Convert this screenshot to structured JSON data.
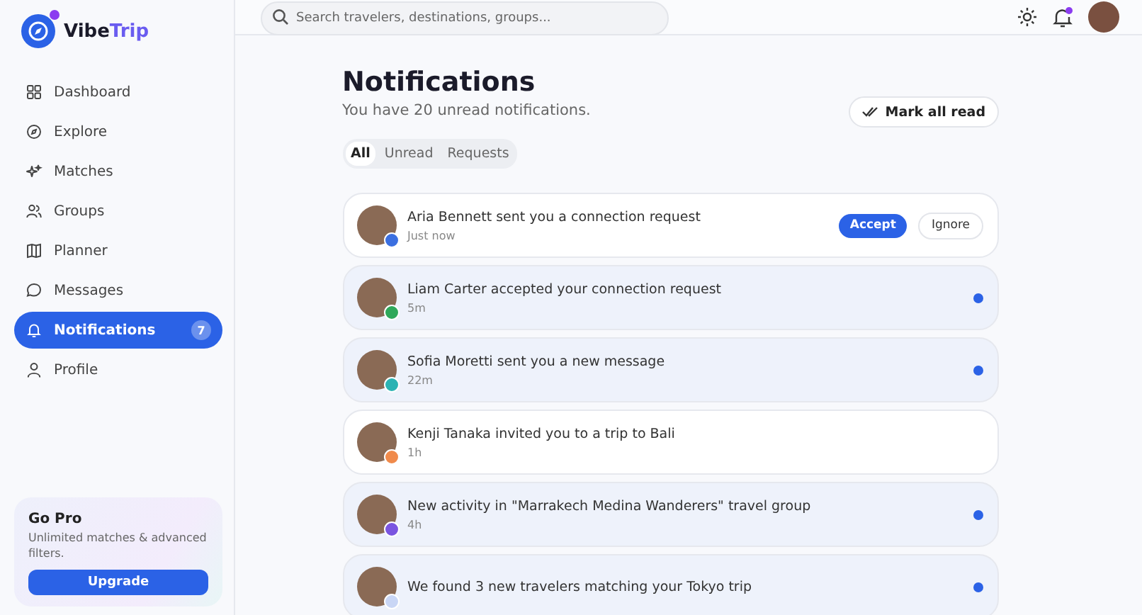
{
  "brand": {
    "name": "Vibe",
    "accent": "Trip"
  },
  "search": {
    "placeholder": "Search travelers, destinations, groups..."
  },
  "sidebar": {
    "items": [
      {
        "label": "Dashboard",
        "selected": false
      },
      {
        "label": "Explore",
        "selected": false
      },
      {
        "label": "Matches",
        "selected": false
      },
      {
        "label": "Groups",
        "selected": false
      },
      {
        "label": "Planner",
        "selected": false
      },
      {
        "label": "Messages",
        "selected": false
      },
      {
        "label": "Notifications",
        "selected": true,
        "badge": "7"
      },
      {
        "label": "Profile",
        "selected": false
      }
    ],
    "promo": {
      "title": "Go Pro",
      "text": "Unlimited matches & advanced filters.",
      "button": "Upgrade"
    }
  },
  "page": {
    "title": "Notifications",
    "subtitle": "You have 20 unread notifications.",
    "mark_all": "Mark all read"
  },
  "filters": [
    {
      "label": "All",
      "selected": true
    },
    {
      "label": "Unread",
      "selected": false
    },
    {
      "label": "Requests",
      "selected": false
    }
  ],
  "notifications": [
    {
      "kind": "request",
      "text": "Aria Bennett sent you a connection request",
      "time": "Just now",
      "unread": false,
      "color": "#3b6fe0",
      "actions": [
        "Accept",
        "Ignore"
      ]
    },
    {
      "kind": "plain",
      "text": "Liam Carter accepted your connection request",
      "time": "5m",
      "unread": true,
      "color": "#2fa85a"
    },
    {
      "kind": "plain",
      "text": "Sofia Moretti sent you a new message",
      "time": "22m",
      "unread": true,
      "color": "#2bb3b3"
    },
    {
      "kind": "plain",
      "text": "Kenji Tanaka invited you to a trip to Bali",
      "time": "1h",
      "unread": false,
      "color": "#f08a4b"
    },
    {
      "kind": "plain",
      "text": "New activity in \"Marrakech Medina Wanderers\" travel group",
      "time": "4h",
      "unread": true,
      "color": "#7a55e0"
    },
    {
      "kind": "plain",
      "text": "We found 3 new travelers matching your Tokyo trip",
      "unread": true,
      "color": "#c9d6f5"
    }
  ]
}
